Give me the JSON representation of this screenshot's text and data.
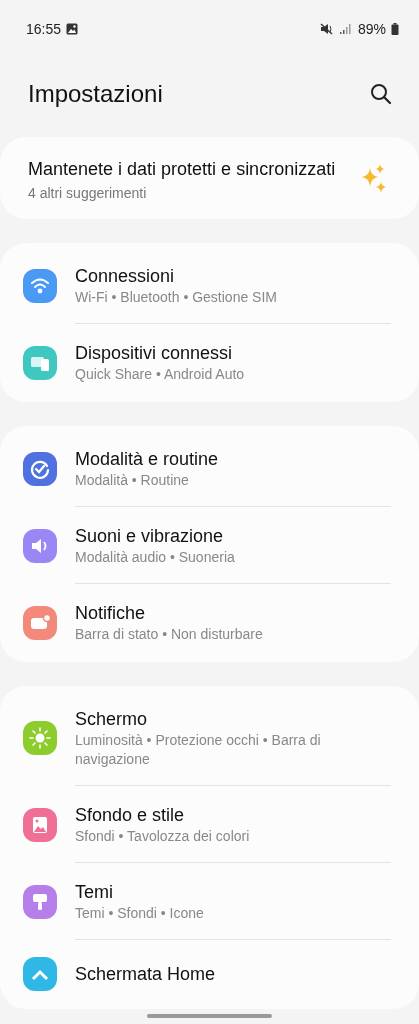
{
  "status_bar": {
    "time": "16:55",
    "battery": "89%"
  },
  "header": {
    "title": "Impostazioni"
  },
  "suggestion": {
    "title": "Mantenete i dati protetti e sincronizzati",
    "subtitle": "4 altri suggerimenti"
  },
  "groups": [
    {
      "items": [
        {
          "title": "Connessioni",
          "subtitle": "Wi-Fi • Bluetooth • Gestione SIM",
          "color": "#4a9af5"
        },
        {
          "title": "Dispositivi connessi",
          "subtitle": "Quick Share • Android Auto",
          "color": "#3ec8c0"
        }
      ]
    },
    {
      "items": [
        {
          "title": "Modalità e routine",
          "subtitle": "Modalità • Routine",
          "color": "#4f72e0"
        },
        {
          "title": "Suoni e vibrazione",
          "subtitle": "Modalità audio • Suoneria",
          "color": "#9a86f5"
        },
        {
          "title": "Notifiche",
          "subtitle": "Barra di stato • Non disturbare",
          "color": "#f3897a"
        }
      ]
    },
    {
      "items": [
        {
          "title": "Schermo",
          "subtitle": "Luminosità • Protezione occhi • Barra di navigazione",
          "color": "#8ccc2c"
        },
        {
          "title": "Sfondo e stile",
          "subtitle": "Sfondi • Tavolozza dei colori",
          "color": "#ef6f95"
        },
        {
          "title": "Temi",
          "subtitle": "Temi • Sfondi • Icone",
          "color": "#b57ee8"
        },
        {
          "title": "Schermata Home",
          "color": "#2fb8e6"
        }
      ]
    }
  ]
}
